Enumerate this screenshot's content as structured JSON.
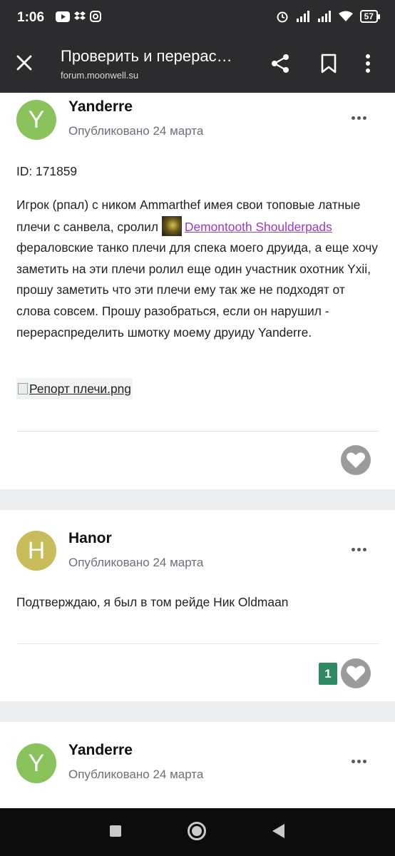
{
  "status_bar": {
    "time": "1:06",
    "battery": "57"
  },
  "app_bar": {
    "title": "Проверить и перерас…",
    "url": "forum.moonwell.su"
  },
  "posts": [
    {
      "avatar_letter": "Y",
      "avatar_color": "#8ac35b",
      "author": "Yanderre",
      "date": "Опубликовано 24 марта",
      "id_line": "ID: 171859",
      "text_before_link": "Игрок (рпал) с ником Ammarthef имея свои топовые латные плечи с санвела, сролил ",
      "item_link": "Demontooth Shoulderpads",
      "text_after_link": " фераловские танко плечи для спека моего друида, а еще хочу заметить на эти плечи ролил еще один участник охотник Yxii, прошу заметить что эти плечи ему так же не подходят от слова совсем. Прошу разобраться, если он нарушил - перераспределить шмотку моему друиду Yanderre.",
      "attachment": "Репорт плечи.png"
    },
    {
      "avatar_letter": "H",
      "avatar_color": "#c8bd5a",
      "author": "Hanor",
      "date": "Опубликовано 24 марта",
      "text": "Подтверждаю, я был в том рейде Ник Oldmaan",
      "reaction_count": "1"
    },
    {
      "avatar_letter": "Y",
      "avatar_color": "#8ac35b",
      "author": "Yanderre",
      "date": "Опубликовано 24 марта"
    }
  ],
  "icons": {
    "close": "close-icon",
    "share": "share-icon",
    "bookmark": "bookmark-icon",
    "more": "more-vertical-icon",
    "like": "heart-icon",
    "post_menu": "more-horizontal-icon"
  }
}
